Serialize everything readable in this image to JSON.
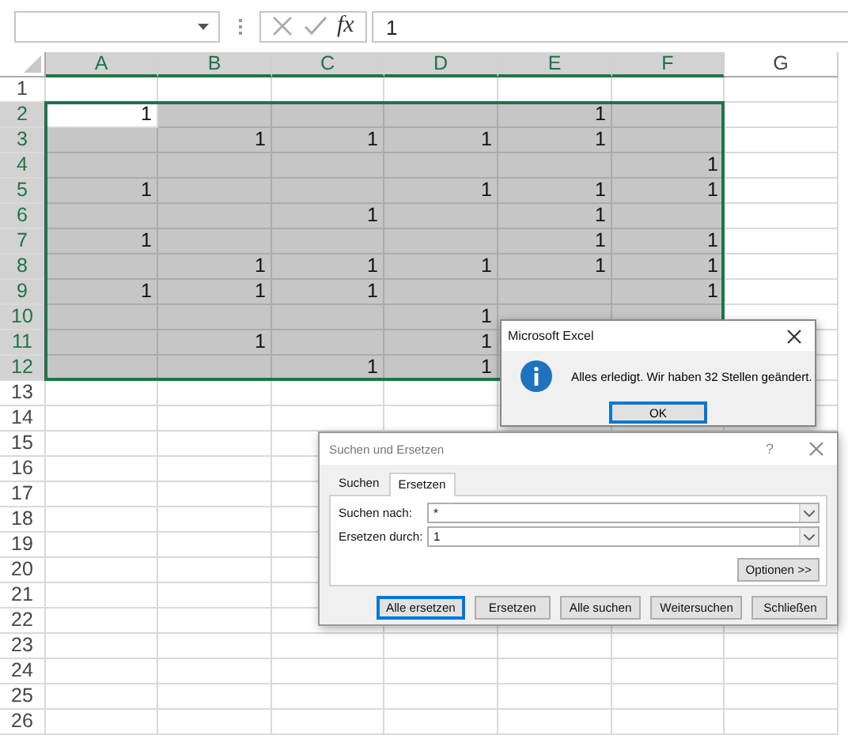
{
  "formula_bar": {
    "fx_label": "fx",
    "cancel_enabled": false,
    "enter_enabled": false,
    "formula": "1"
  },
  "columns": [
    {
      "label": "A",
      "selected": true
    },
    {
      "label": "B",
      "selected": true
    },
    {
      "label": "C",
      "selected": true
    },
    {
      "label": "D",
      "selected": true
    },
    {
      "label": "E",
      "selected": true
    },
    {
      "label": "F",
      "selected": true
    },
    {
      "label": "G",
      "selected": false
    }
  ],
  "rows": [
    {
      "header": "1",
      "selected": false
    },
    {
      "header": "2",
      "selected": true,
      "cells": [
        {
          "value": "1",
          "active": true
        },
        {
          "active": false
        },
        {
          "active": false
        },
        {
          "active": false
        },
        {
          "value": "1",
          "active": false
        },
        {
          "active": false
        }
      ]
    },
    {
      "header": "3",
      "selected": true,
      "cells": [
        {
          "active": false
        },
        {
          "value": "1",
          "active": false
        },
        {
          "value": "1",
          "active": false
        },
        {
          "value": "1",
          "active": false
        },
        {
          "value": "1",
          "active": false
        },
        {
          "active": false
        }
      ]
    },
    {
      "header": "4",
      "selected": true,
      "cells": [
        {
          "active": false
        },
        {
          "active": false
        },
        {
          "active": false
        },
        {
          "active": false
        },
        {
          "active": false
        },
        {
          "value": "1",
          "active": false
        }
      ]
    },
    {
      "header": "5",
      "selected": true,
      "cells": [
        {
          "value": "1",
          "active": false
        },
        {
          "active": false
        },
        {
          "active": false
        },
        {
          "value": "1",
          "active": false
        },
        {
          "value": "1",
          "active": false
        },
        {
          "value": "1",
          "active": false
        }
      ]
    },
    {
      "header": "6",
      "selected": true,
      "cells": [
        {
          "active": false
        },
        {
          "active": false
        },
        {
          "value": "1",
          "active": false
        },
        {
          "active": false
        },
        {
          "value": "1",
          "active": false
        },
        {
          "active": false
        }
      ]
    },
    {
      "header": "7",
      "selected": true,
      "cells": [
        {
          "value": "1",
          "active": false
        },
        {
          "active": false
        },
        {
          "active": false
        },
        {
          "active": false
        },
        {
          "value": "1",
          "active": false
        },
        {
          "value": "1",
          "active": false
        }
      ]
    },
    {
      "header": "8",
      "selected": true,
      "cells": [
        {
          "active": false
        },
        {
          "value": "1",
          "active": false
        },
        {
          "value": "1",
          "active": false
        },
        {
          "value": "1",
          "active": false
        },
        {
          "value": "1",
          "active": false
        },
        {
          "value": "1",
          "active": false
        }
      ]
    },
    {
      "header": "9",
      "selected": true,
      "cells": [
        {
          "value": "1",
          "active": false
        },
        {
          "value": "1",
          "active": false
        },
        {
          "value": "1",
          "active": false
        },
        {
          "active": false
        },
        {
          "active": false
        },
        {
          "value": "1",
          "active": false
        }
      ]
    },
    {
      "header": "10",
      "selected": true,
      "cells": [
        {
          "active": false
        },
        {
          "active": false
        },
        {
          "active": false
        },
        {
          "value": "1",
          "active": false
        },
        {
          "active": false
        },
        {
          "active": false
        }
      ]
    },
    {
      "header": "11",
      "selected": true,
      "cells": [
        {
          "active": false
        },
        {
          "value": "1",
          "active": false
        },
        {
          "active": false
        },
        {
          "value": "1",
          "active": false
        }
      ]
    },
    {
      "header": "12",
      "selected": true,
      "cells": [
        {
          "active": false
        },
        {
          "active": false
        },
        {
          "value": "1",
          "active": false
        },
        {
          "value": "1",
          "active": false
        }
      ]
    },
    {
      "header": "13",
      "selected": false
    },
    {
      "header": "14",
      "selected": false
    },
    {
      "header": "15",
      "selected": false
    },
    {
      "header": "16",
      "selected": false
    },
    {
      "header": "17",
      "selected": false
    },
    {
      "header": "18",
      "selected": false
    },
    {
      "header": "19",
      "selected": false
    },
    {
      "header": "20",
      "selected": false
    },
    {
      "header": "21",
      "selected": false
    },
    {
      "header": "22",
      "selected": false
    },
    {
      "header": "23",
      "selected": false
    },
    {
      "header": "24",
      "selected": false
    },
    {
      "header": "25",
      "selected": false
    },
    {
      "header": "26",
      "selected": false
    }
  ],
  "message_box": {
    "title": "Microsoft Excel",
    "text": "Alles erledigt. Wir haben 32 Stellen geändert.",
    "buttons": [
      {
        "label": "OK",
        "default": true
      }
    ]
  },
  "find_dialog": {
    "title": "Suchen und Ersetzen",
    "help": "?",
    "tabs": [
      {
        "label": "Suchen",
        "selected": false
      },
      {
        "label": "Ersetzen",
        "selected": true
      }
    ],
    "fields": [
      {
        "label": "Suchen nach:",
        "value": "*"
      },
      {
        "label": "Ersetzen durch:",
        "value": "1"
      }
    ],
    "options_button": "Optionen >>",
    "buttons": [
      {
        "label": "Alle ersetzen",
        "default": true
      },
      {
        "label": "Ersetzen",
        "default": false
      },
      {
        "label": "Alle suchen",
        "default": false
      },
      {
        "label": "Weitersuchen",
        "default": false
      },
      {
        "label": "Schließen",
        "default": false
      }
    ]
  }
}
